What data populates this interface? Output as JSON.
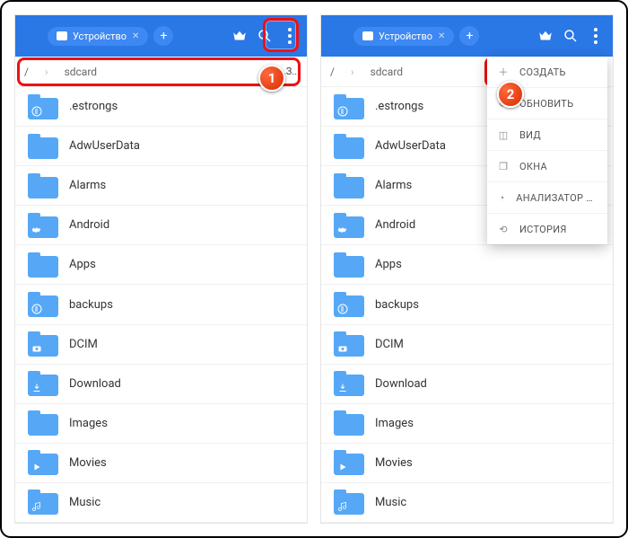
{
  "topbar": {
    "tab_label": "Устройство",
    "plus_label": "+"
  },
  "breadcrumb": {
    "root": "/",
    "path": "sdcard",
    "right_label": "А..З..."
  },
  "folders": [
    {
      "name": ".estrongs",
      "badge": "es"
    },
    {
      "name": "AdwUserData",
      "badge": ""
    },
    {
      "name": "Alarms",
      "badge": ""
    },
    {
      "name": "Android",
      "badge": "gear"
    },
    {
      "name": "Apps",
      "badge": ""
    },
    {
      "name": "backups",
      "badge": "es"
    },
    {
      "name": "DCIM",
      "badge": "camera"
    },
    {
      "name": "Download",
      "badge": "download"
    },
    {
      "name": "Images",
      "badge": ""
    },
    {
      "name": "Movies",
      "badge": "play"
    },
    {
      "name": "Music",
      "badge": "music"
    }
  ],
  "menu": {
    "items": [
      {
        "icon": "plus",
        "label": "СОЗДАТЬ"
      },
      {
        "icon": "refresh",
        "label": "ОБНОВИТЬ"
      },
      {
        "icon": "view",
        "label": "ВИД"
      },
      {
        "icon": "windows",
        "label": "ОКНА"
      },
      {
        "icon": "analyzer",
        "label": "АНАЛИЗАТОР ФАЙЛ..."
      },
      {
        "icon": "history",
        "label": "ИСТОРИЯ"
      }
    ]
  },
  "annotations": {
    "badge1": "1",
    "badge2": "2"
  }
}
